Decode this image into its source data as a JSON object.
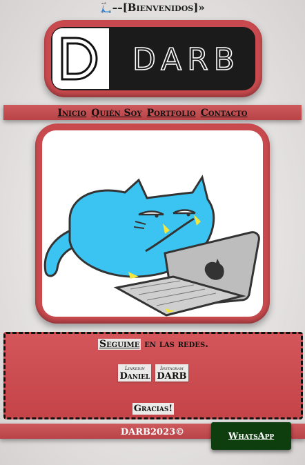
{
  "header": {
    "icon": "kick-scooter-icon",
    "title": "––[Bienvenidos]»"
  },
  "logo": {
    "letter": "D",
    "word": "DARB"
  },
  "nav": {
    "items": [
      "Inicio",
      "Quién Soy",
      "Portfolio",
      "Contacto"
    ]
  },
  "hero": {
    "image": "cat-using-laptop-illustration"
  },
  "social": {
    "follow_prefix": "Seguime",
    "follow_suffix": " en las redes.",
    "cards": [
      {
        "network": "Linkedin",
        "user": "Daniel"
      },
      {
        "network": "Instagram",
        "user": "DARB"
      }
    ],
    "thanks": "Gracias!"
  },
  "footer": {
    "copyright": "DARB2023©",
    "whatsapp_label": "WhatsApp"
  },
  "colors": {
    "frame_red": "#c84a4e",
    "logo_dark": "#1b1b1b",
    "cat_blue": "#3bc4f2",
    "whatsapp_green": "#0e3d0e"
  }
}
